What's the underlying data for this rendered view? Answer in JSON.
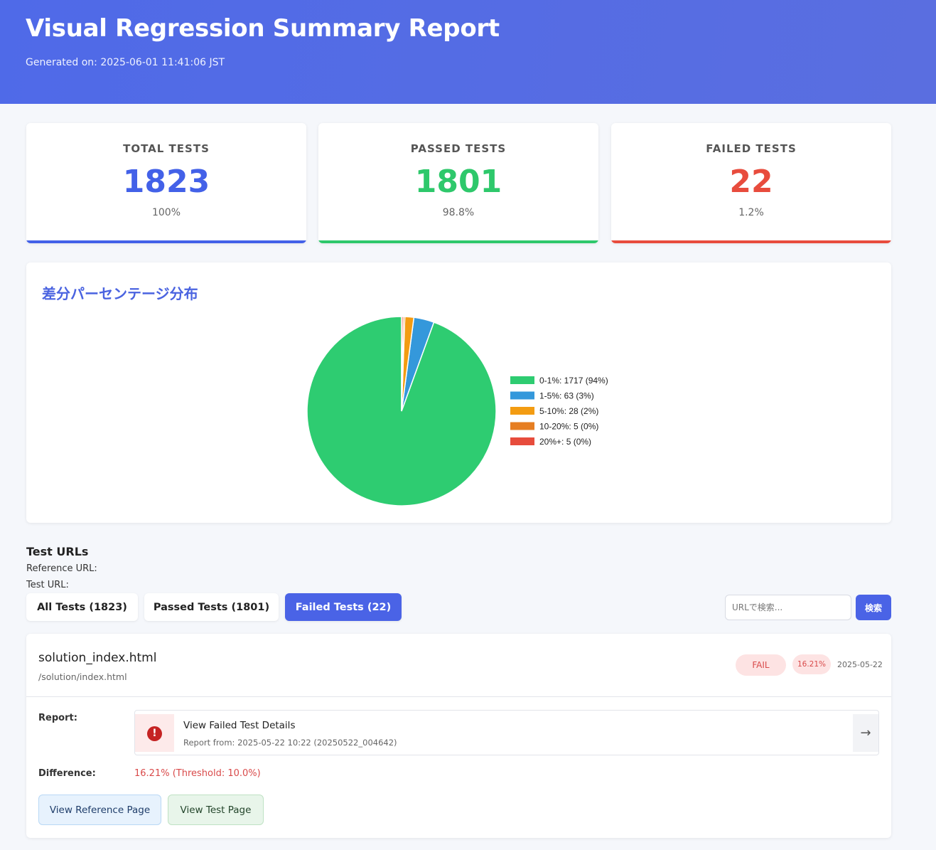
{
  "header": {
    "title": "Visual Regression Summary Report",
    "generated": "Generated on: 2025-06-01 11:41:06 JST"
  },
  "summary": [
    {
      "label": "TOTAL TESTS",
      "value": "1823",
      "percent": "100%",
      "color": "#4361e8"
    },
    {
      "label": "PASSED TESTS",
      "value": "1801",
      "percent": "98.8%",
      "color": "#2ec86b"
    },
    {
      "label": "FAILED TESTS",
      "value": "22",
      "percent": "1.2%",
      "color": "#e84c3d"
    }
  ],
  "chart_title": "差分パーセンテージ分布",
  "chart_data": {
    "type": "pie",
    "categories": [
      "0-1%",
      "1-5%",
      "5-10%",
      "10-20%",
      "20%+"
    ],
    "values": [
      1717,
      63,
      28,
      5,
      5
    ],
    "colors": [
      "#2ecc71",
      "#3498db",
      "#f39c12",
      "#e67e22",
      "#e74c3c"
    ],
    "legend_labels": [
      "0-1%: 1717 (94%)",
      "1-5%: 63 (3%)",
      "5-10%: 28 (2%)",
      "10-20%: 5 (0%)",
      "20%+: 5 (0%)"
    ],
    "legend_position": "right"
  },
  "urls": {
    "title": "Test URLs",
    "reference_label": "Reference URL:",
    "test_label": "Test URL:"
  },
  "tabs": [
    {
      "label": "All Tests (1823)",
      "active": false
    },
    {
      "label": "Passed Tests (1801)",
      "active": false
    },
    {
      "label": "Failed Tests (22)",
      "active": true
    }
  ],
  "search": {
    "placeholder": "URLで検索...",
    "button": "検索"
  },
  "result": {
    "name": "solution_index.html",
    "path": "/solution/index.html",
    "status": "FAIL",
    "diff_badge": "16.21%",
    "date": "2025-05-22",
    "report_label": "Report:",
    "report_icon": "alert-circle-icon",
    "report_title": "View Failed Test Details",
    "report_sub": "Report from: 2025-05-22 10:22 (20250522_004642)",
    "difference_label": "Difference:",
    "difference_value": "16.21% (Threshold: 10.0%)",
    "view_reference": "View Reference Page",
    "view_test": "View Test Page"
  }
}
